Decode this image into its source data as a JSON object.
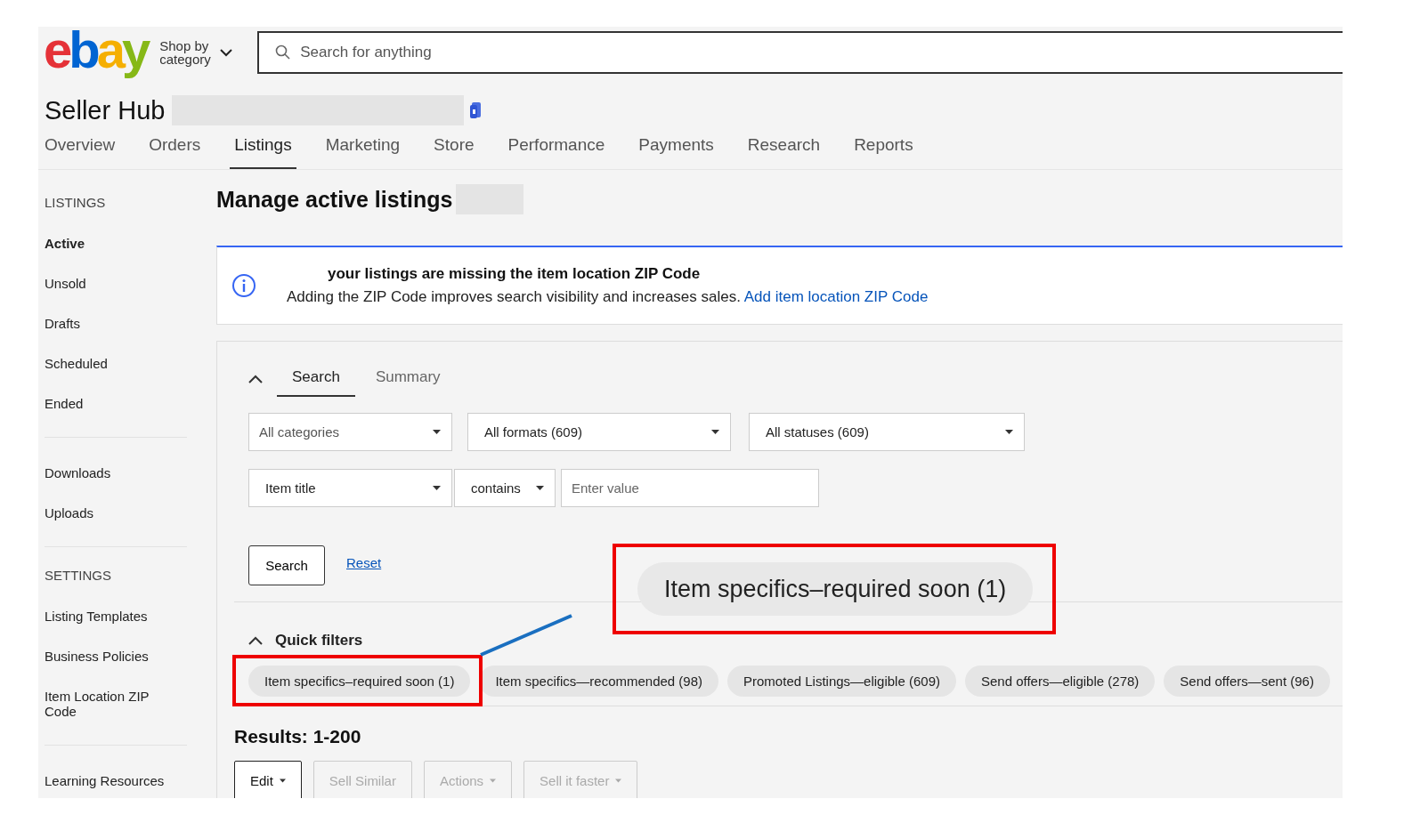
{
  "header": {
    "logo": [
      {
        "char": "e",
        "color": "#e53238"
      },
      {
        "char": "b",
        "color": "#0064d2"
      },
      {
        "char": "a",
        "color": "#f5af02"
      },
      {
        "char": "y",
        "color": "#86b817"
      }
    ],
    "shop_by_category": "Shop by category",
    "search": {
      "placeholder": "Search for anything"
    }
  },
  "title": "Seller Hub",
  "nav": [
    {
      "label": "Overview",
      "selected": false
    },
    {
      "label": "Orders",
      "selected": false
    },
    {
      "label": "Listings",
      "selected": true
    },
    {
      "label": "Marketing",
      "selected": false
    },
    {
      "label": "Store",
      "selected": false
    },
    {
      "label": "Performance",
      "selected": false
    },
    {
      "label": "Payments",
      "selected": false
    },
    {
      "label": "Research",
      "selected": false
    },
    {
      "label": "Reports",
      "selected": false
    }
  ],
  "sidebar": [
    {
      "heading": "LISTINGS",
      "items": [
        {
          "label": "Active",
          "selected": true
        },
        {
          "label": "Unsold",
          "selected": false
        },
        {
          "label": "Drafts",
          "selected": false
        },
        {
          "label": "Scheduled",
          "selected": false
        },
        {
          "label": "Ended",
          "selected": false
        }
      ]
    },
    {
      "items": [
        {
          "label": "Downloads",
          "selected": false
        },
        {
          "label": "Uploads",
          "selected": false
        }
      ]
    },
    {
      "heading": "SETTINGS",
      "items": [
        {
          "label": "Listing Templates",
          "selected": false
        },
        {
          "label": "Business Policies",
          "selected": false
        },
        {
          "label": "Item Location ZIP Code",
          "selected": false
        }
      ]
    },
    {
      "items": [
        {
          "label": "Learning Resources",
          "selected": false
        }
      ]
    }
  ],
  "page_title": "Manage active listings",
  "notice": {
    "title": "your listings are missing the item location ZIP Code",
    "text": "Adding the ZIP Code improves search visibility and increases sales.",
    "link": "Add item location ZIP Code"
  },
  "search_panel": {
    "tabs": [
      {
        "label": "Search",
        "selected": true
      },
      {
        "label": "Summary",
        "selected": false
      }
    ],
    "selects": [
      {
        "label": "All categories",
        "placeholder": true
      },
      {
        "label": "All formats (609)",
        "placeholder": false
      },
      {
        "label": "All statuses (609)",
        "placeholder": false
      }
    ],
    "field_select": "Item title",
    "operator_select": "contains",
    "value": {
      "placeholder": "Enter value"
    },
    "search_button": "Search",
    "reset_link": "Reset"
  },
  "quick_filters": {
    "heading": "Quick filters",
    "chips": [
      "Item specifics–required soon (1)",
      "Item specifics—recommended (98)",
      "Promoted Listings—eligible (609)",
      "Send offers—eligible (278)",
      "Send offers—sent (96)"
    ]
  },
  "results": "Results: 1-200",
  "actions": [
    {
      "label": "Edit",
      "disabled": false,
      "dropdown": true
    },
    {
      "label": "Sell Similar",
      "disabled": true,
      "dropdown": false
    },
    {
      "label": "Actions",
      "disabled": true,
      "dropdown": true
    },
    {
      "label": "Sell it faster",
      "disabled": true,
      "dropdown": true
    }
  ],
  "callout": {
    "text": "Item specifics–required soon (1)"
  }
}
